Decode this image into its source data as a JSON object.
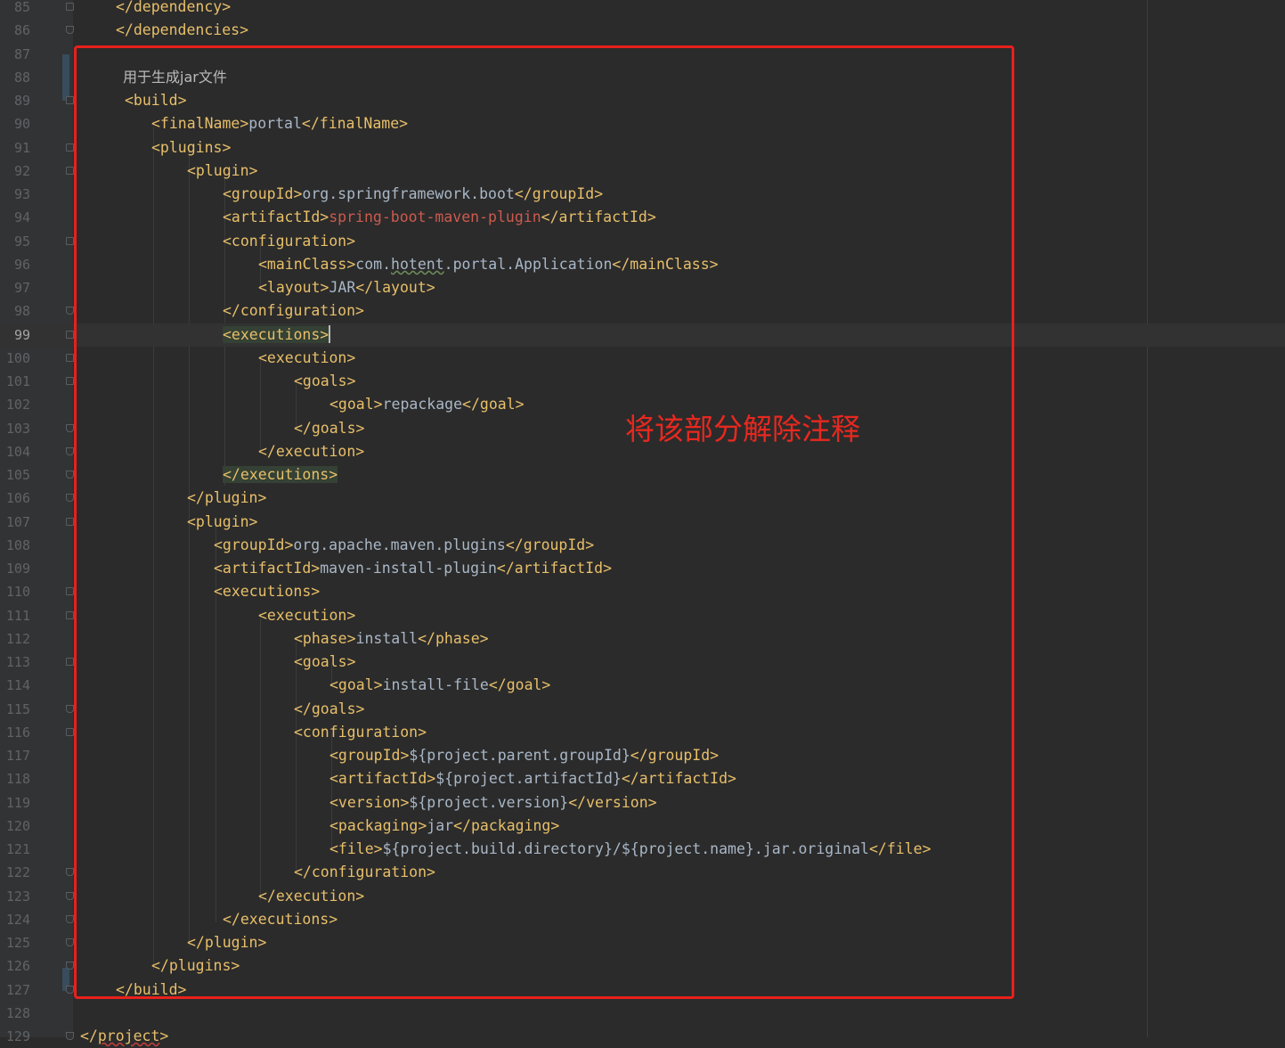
{
  "editor": {
    "current_line": 99,
    "lines": [
      {
        "n": "85",
        "fold": "open",
        "parts": [
          {
            "t": "</dependency>",
            "c": "tag"
          }
        ]
      },
      {
        "n": "86",
        "fold": "end",
        "parts": [
          {
            "t": "</dependencies>",
            "c": "tag"
          }
        ]
      },
      {
        "n": "87",
        "parts": []
      },
      {
        "n": "88",
        "parts": [
          {
            "t": "用于生成jar文件",
            "c": "cmt"
          }
        ]
      },
      {
        "n": "89",
        "fold": "open",
        "parts": [
          {
            "t": "<build>",
            "c": "tag"
          }
        ]
      },
      {
        "n": "90",
        "parts": [
          {
            "t": "<finalName>",
            "c": "tag"
          },
          {
            "t": "portal",
            "c": "val"
          },
          {
            "t": "</finalName>",
            "c": "tag"
          }
        ]
      },
      {
        "n": "91",
        "fold": "open",
        "parts": [
          {
            "t": "<plugins>",
            "c": "tag"
          }
        ]
      },
      {
        "n": "92",
        "fold": "open",
        "parts": [
          {
            "t": "<plugin>",
            "c": "tag"
          }
        ]
      },
      {
        "n": "93",
        "parts": [
          {
            "t": "<groupId>",
            "c": "tag"
          },
          {
            "t": "org.springframework.boot",
            "c": "val"
          },
          {
            "t": "</groupId>",
            "c": "tag"
          }
        ]
      },
      {
        "n": "94",
        "parts": [
          {
            "t": "<artifactId>",
            "c": "tag"
          },
          {
            "t": "spring-boot-maven-plugin",
            "c": "err"
          },
          {
            "t": "</artifactId>",
            "c": "tag"
          }
        ]
      },
      {
        "n": "95",
        "fold": "open",
        "parts": [
          {
            "t": "<configuration>",
            "c": "tag"
          }
        ]
      },
      {
        "n": "96",
        "parts": [
          {
            "t": "<mainClass>",
            "c": "tag"
          },
          {
            "t": "com.",
            "c": "val"
          },
          {
            "t": "hotent",
            "c": "val squig"
          },
          {
            "t": ".portal.Application",
            "c": "val"
          },
          {
            "t": "</mainClass>",
            "c": "tag"
          }
        ]
      },
      {
        "n": "97",
        "parts": [
          {
            "t": "<layout>",
            "c": "tag"
          },
          {
            "t": "JAR",
            "c": "val"
          },
          {
            "t": "</layout>",
            "c": "tag"
          }
        ]
      },
      {
        "n": "98",
        "fold": "end",
        "parts": [
          {
            "t": "</configuration>",
            "c": "tag"
          }
        ]
      },
      {
        "n": "99",
        "fold": "open",
        "parts": [
          {
            "t": "<executions>",
            "c": "tag hl"
          },
          {
            "t": "",
            "c": "caret"
          }
        ]
      },
      {
        "n": "100",
        "fold": "open",
        "parts": [
          {
            "t": "<execution>",
            "c": "tag"
          }
        ]
      },
      {
        "n": "101",
        "fold": "open",
        "parts": [
          {
            "t": "<goals>",
            "c": "tag"
          }
        ]
      },
      {
        "n": "102",
        "parts": [
          {
            "t": "<goal>",
            "c": "tag"
          },
          {
            "t": "repackage",
            "c": "val"
          },
          {
            "t": "</goal>",
            "c": "tag"
          }
        ]
      },
      {
        "n": "103",
        "fold": "end",
        "parts": [
          {
            "t": "</goals>",
            "c": "tag"
          }
        ]
      },
      {
        "n": "104",
        "fold": "end",
        "parts": [
          {
            "t": "</execution>",
            "c": "tag"
          }
        ]
      },
      {
        "n": "105",
        "fold": "end",
        "parts": [
          {
            "t": "</executions>",
            "c": "tag hl"
          }
        ]
      },
      {
        "n": "106",
        "fold": "end",
        "parts": [
          {
            "t": "</plugin>",
            "c": "tag"
          }
        ]
      },
      {
        "n": "107",
        "fold": "open",
        "parts": [
          {
            "t": "<plugin>",
            "c": "tag"
          }
        ]
      },
      {
        "n": "108",
        "parts": [
          {
            "t": "<groupId>",
            "c": "tag"
          },
          {
            "t": "org.apache.maven.plugins",
            "c": "val"
          },
          {
            "t": "</groupId>",
            "c": "tag"
          }
        ]
      },
      {
        "n": "109",
        "parts": [
          {
            "t": "<artifactId>",
            "c": "tag"
          },
          {
            "t": "maven-install-plugin",
            "c": "val"
          },
          {
            "t": "</artifactId>",
            "c": "tag"
          }
        ]
      },
      {
        "n": "110",
        "fold": "open",
        "parts": [
          {
            "t": "<executions>",
            "c": "tag"
          }
        ]
      },
      {
        "n": "111",
        "fold": "open",
        "parts": [
          {
            "t": "<execution>",
            "c": "tag"
          }
        ]
      },
      {
        "n": "112",
        "parts": [
          {
            "t": "<phase>",
            "c": "tag"
          },
          {
            "t": "install",
            "c": "val"
          },
          {
            "t": "</phase>",
            "c": "tag"
          }
        ]
      },
      {
        "n": "113",
        "fold": "open",
        "parts": [
          {
            "t": "<goals>",
            "c": "tag"
          }
        ]
      },
      {
        "n": "114",
        "parts": [
          {
            "t": "<goal>",
            "c": "tag"
          },
          {
            "t": "install-file",
            "c": "val"
          },
          {
            "t": "</goal>",
            "c": "tag"
          }
        ]
      },
      {
        "n": "115",
        "fold": "end",
        "parts": [
          {
            "t": "</goals>",
            "c": "tag"
          }
        ]
      },
      {
        "n": "116",
        "fold": "open",
        "parts": [
          {
            "t": "<configuration>",
            "c": "tag"
          }
        ]
      },
      {
        "n": "117",
        "parts": [
          {
            "t": "<groupId>",
            "c": "tag"
          },
          {
            "t": "${project.parent.groupId}",
            "c": "val"
          },
          {
            "t": "</groupId>",
            "c": "tag"
          }
        ]
      },
      {
        "n": "118",
        "parts": [
          {
            "t": "<artifactId>",
            "c": "tag"
          },
          {
            "t": "${project.artifactId}",
            "c": "val"
          },
          {
            "t": "</artifactId>",
            "c": "tag"
          }
        ]
      },
      {
        "n": "119",
        "parts": [
          {
            "t": "<version>",
            "c": "tag"
          },
          {
            "t": "${project.version}",
            "c": "val"
          },
          {
            "t": "</version>",
            "c": "tag"
          }
        ]
      },
      {
        "n": "120",
        "parts": [
          {
            "t": "<packaging>",
            "c": "tag"
          },
          {
            "t": "jar",
            "c": "val"
          },
          {
            "t": "</packaging>",
            "c": "tag"
          }
        ]
      },
      {
        "n": "121",
        "parts": [
          {
            "t": "<file>",
            "c": "tag"
          },
          {
            "t": "${project.build.directory}/${project.name}.jar.original",
            "c": "val"
          },
          {
            "t": "</file>",
            "c": "tag"
          }
        ]
      },
      {
        "n": "122",
        "fold": "end",
        "parts": [
          {
            "t": "</configuration>",
            "c": "tag"
          }
        ]
      },
      {
        "n": "123",
        "fold": "end",
        "parts": [
          {
            "t": "</execution>",
            "c": "tag"
          }
        ]
      },
      {
        "n": "124",
        "fold": "end",
        "parts": [
          {
            "t": "</executions>",
            "c": "tag"
          }
        ]
      },
      {
        "n": "125",
        "fold": "end",
        "parts": [
          {
            "t": "</plugin>",
            "c": "tag"
          }
        ]
      },
      {
        "n": "126",
        "fold": "end",
        "parts": [
          {
            "t": "</plugins>",
            "c": "tag"
          }
        ]
      },
      {
        "n": "127",
        "fold": "end",
        "parts": [
          {
            "t": "</build>",
            "c": "tag"
          }
        ]
      },
      {
        "n": "128",
        "parts": []
      },
      {
        "n": "129",
        "fold": "end",
        "parts": [
          {
            "t": "</",
            "c": "tag"
          },
          {
            "t": "project",
            "c": "tag squig-red"
          },
          {
            "t": ">",
            "c": "tag"
          }
        ]
      }
    ]
  },
  "annotation": {
    "text": "将该部分解除注释",
    "color": "#e8201c"
  }
}
